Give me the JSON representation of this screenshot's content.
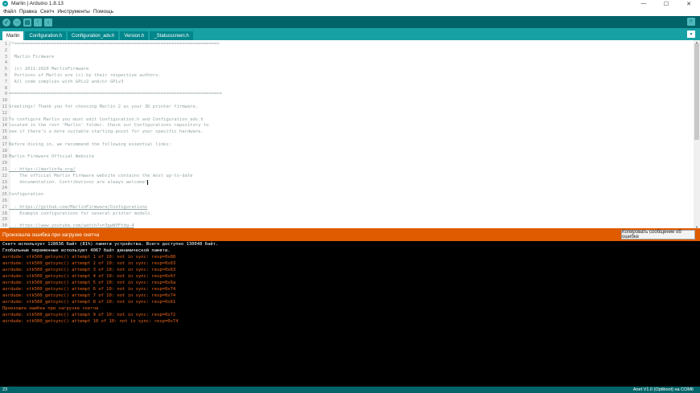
{
  "window": {
    "title": "Marlin | Arduino 1.8.13",
    "app_icon": "arduino-logo-icon",
    "controls": [
      "—",
      "☐",
      "✕"
    ]
  },
  "menu": [
    "Файл",
    "Правка",
    "Скетч",
    "Инструменты",
    "Помощь"
  ],
  "toolbar": {
    "buttons": [
      {
        "name": "verify",
        "icon": "check-icon",
        "glyph": "✓"
      },
      {
        "name": "upload",
        "icon": "arrow-right-icon",
        "glyph": "→"
      },
      {
        "name": "new",
        "icon": "new-file-icon",
        "glyph": "▤"
      },
      {
        "name": "open",
        "icon": "arrow-up-icon",
        "glyph": "↑"
      },
      {
        "name": "save",
        "icon": "arrow-down-icon",
        "glyph": "↓"
      }
    ],
    "serial_monitor_glyph": "⌕"
  },
  "tabs": [
    "Marlin",
    "Configuration.h",
    "Configuration_adv.h",
    "Version.h",
    "_Statusscreen.h"
  ],
  "tab_menu_glyph": "▼",
  "editor": {
    "lines": [
      {
        "n": "1",
        "t": "/*============================================================================="
      },
      {
        "n": "2",
        "t": ""
      },
      {
        "n": "3",
        "t": "  Marlin Firmware"
      },
      {
        "n": "4",
        "t": ""
      },
      {
        "n": "5",
        "t": "  (c) 2011-2020 MarlinFirmware"
      },
      {
        "n": "6",
        "t": "  Portions of Marlin are (c) by their respective authors."
      },
      {
        "n": "7",
        "t": "  All code complies with GPLv2 and/or GPLv3"
      },
      {
        "n": "8",
        "t": ""
      },
      {
        "n": "9",
        "t": "================================================================================"
      },
      {
        "n": "10",
        "t": ""
      },
      {
        "n": "11",
        "t": "Greetings! Thank you for choosing Marlin 2 as your 3D printer firmware."
      },
      {
        "n": "12",
        "t": ""
      },
      {
        "n": "13",
        "t": "To configure Marlin you must edit Configuration.h and Configuration_adv.h"
      },
      {
        "n": "14",
        "t": "located in the root 'Marlin' folder. Check our Configurations repository to"
      },
      {
        "n": "15",
        "t": "see if there's a more suitable starting-point for your specific hardware."
      },
      {
        "n": "16",
        "t": ""
      },
      {
        "n": "17",
        "t": "Before diving in, we recommend the following essential links:"
      },
      {
        "n": "18",
        "t": ""
      },
      {
        "n": "19",
        "t": "Marlin Firmware Official Website"
      },
      {
        "n": "20",
        "t": ""
      },
      {
        "n": "21",
        "t": "  - https://marlinfw.org/"
      },
      {
        "n": "22",
        "t": "    The official Marlin Firmware website contains the most up-to-date"
      },
      {
        "n": "23",
        "t": "    documentation. Contributions are always welcome!"
      },
      {
        "n": "24",
        "t": ""
      },
      {
        "n": "25",
        "t": "Configuration"
      },
      {
        "n": "26",
        "t": ""
      },
      {
        "n": "27",
        "t": "  - https://github.com/MarlinFirmware/Configurations"
      },
      {
        "n": "28",
        "t": "    Example configurations for several printer models."
      },
      {
        "n": "29",
        "t": ""
      },
      {
        "n": "30",
        "t": "  - https://www.youtube.com/watch?v=3gwWVFtdg-4"
      }
    ]
  },
  "status": {
    "message": "Произошла ошибка при загрузке скетча",
    "copy_button": "Копировать сообщение об ошибке"
  },
  "console": [
    {
      "text": "Скетч использует 128636 байт (81%) памяти устройства. Всего доступно 130048 байт.",
      "level": "info"
    },
    {
      "text": "Глобальные переменные используют 4067 байт динамической памяти.",
      "level": "info"
    },
    {
      "text": "avrdude: stk500_getsync() attempt 1 of 10: not in sync: resp=0x88",
      "level": "error"
    },
    {
      "text": "avrdude: stk500_getsync() attempt 2 of 10: not in sync: resp=0x63",
      "level": "error"
    },
    {
      "text": "avrdude: stk500_getsync() attempt 3 of 10: not in sync: resp=0x63",
      "level": "error"
    },
    {
      "text": "avrdude: stk500_getsync() attempt 4 of 10: not in sync: resp=0x6f",
      "level": "error"
    },
    {
      "text": "avrdude: stk500_getsync() attempt 5 of 10: not in sync: resp=0x6a",
      "level": "error"
    },
    {
      "text": "avrdude: stk500_getsync() attempt 6 of 10: not in sync: resp=0x74",
      "level": "error"
    },
    {
      "text": "avrdude: stk500_getsync() attempt 7 of 10: not in sync: resp=0x74",
      "level": "error"
    },
    {
      "text": "avrdude: stk500_getsync() attempt 8 of 10: not in sync: resp=0x61",
      "level": "error"
    },
    {
      "text": "Произошла ошибка при загрузке скетча",
      "level": "error"
    },
    {
      "text": "avrdude: stk500_getsync() attempt 9 of 10: not in sync: resp=0x72",
      "level": "error"
    },
    {
      "text": "avrdude: stk500_getsync() attempt 10 of 10: not in sync: resp=0x74",
      "level": "error"
    }
  ],
  "footer": {
    "line_number": "23",
    "board": "Anet V1.0 (Optiboot) на COM6"
  }
}
